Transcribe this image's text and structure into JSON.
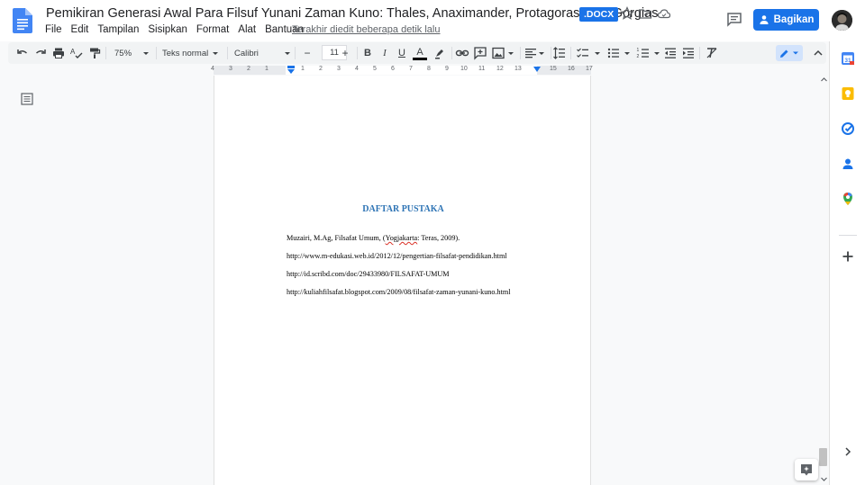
{
  "app": {
    "title": "Pemikiran Generasi Awal  Para Filsuf Yunani Zaman Kuno: Thales, Anaximander, Protagoras, dan Gorgias",
    "badge": ".DOCX",
    "last_edit": "Terakhir diedit beberapa detik lalu",
    "share_label": "Bagikan",
    "accent_color": "#1a73e8"
  },
  "menu": [
    "File",
    "Edit",
    "Tampilan",
    "Sisipkan",
    "Format",
    "Alat",
    "Bantuan"
  ],
  "toolbar": {
    "zoom": "75%",
    "style": "Teks normal",
    "font": "Calibri",
    "font_size": "11",
    "minus": "−",
    "plus": "+",
    "bold": "B",
    "italic": "I",
    "underline": "U",
    "text_color": "A"
  },
  "ruler": {
    "ticks": [
      "4",
      "3",
      "2",
      "1",
      "1",
      "2",
      "3",
      "4",
      "5",
      "6",
      "7",
      "8",
      "9",
      "10",
      "11",
      "12",
      "13",
      "15",
      "16",
      "17"
    ]
  },
  "document": {
    "heading": "DAFTAR PUSTAKA",
    "references": [
      {
        "before": "Muzairi, M.Ag, Filsafat Umum, (",
        "squiggle": "Yogjakarta",
        "after": ": Teras, 2009)."
      },
      {
        "before": "http://www.m-edukasi.web.id/2012/12/pengertian-filsafat-pendidikan.html",
        "squiggle": "",
        "after": ""
      },
      {
        "before": "http://id.scribd.com/doc/29433980/FILSAFAT-UMUM",
        "squiggle": "",
        "after": ""
      },
      {
        "before": "http://kuliahfilsafat.blogspot.com/2009/08/filsafat-zaman-yunani-kuno.html",
        "squiggle": "",
        "after": ""
      }
    ]
  },
  "side_panel": {
    "icons": [
      "calendar-icon",
      "keep-icon",
      "tasks-icon",
      "contacts-icon",
      "maps-icon",
      "add-icon",
      "chevron-right-icon"
    ]
  }
}
